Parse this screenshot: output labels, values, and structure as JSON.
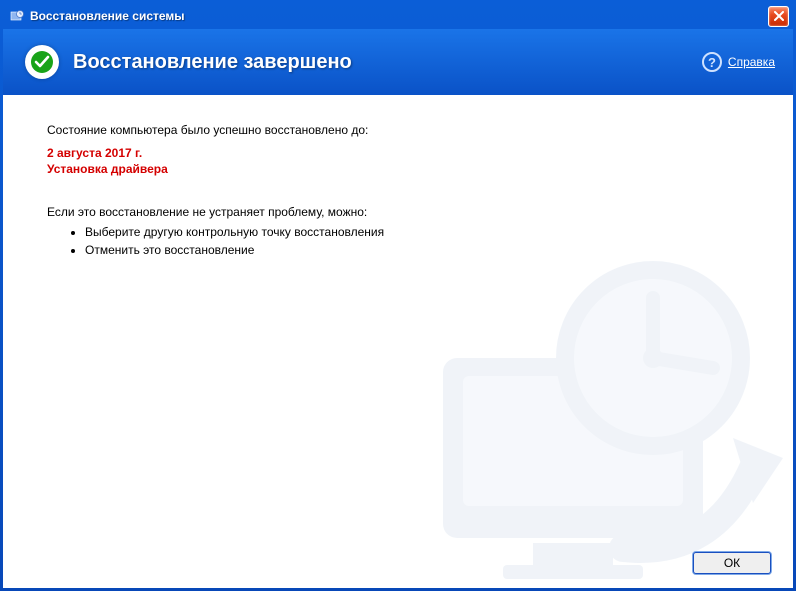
{
  "window": {
    "title": "Восстановление системы"
  },
  "header": {
    "title": "Восстановление завершено",
    "help_label": "Справка"
  },
  "content": {
    "restored_to_label": "Состояние компьютера было успешно восстановлено до:",
    "restore_point_date": "2 августа 2017 г.",
    "restore_point_name": "Установка драйвера",
    "advice_intro": "Если это восстановление не устраняет проблему, можно:",
    "advice_items": [
      "Выберите другую контрольную точку восстановления",
      "Отменить это восстановление"
    ]
  },
  "footer": {
    "ok_label": "ОК"
  }
}
